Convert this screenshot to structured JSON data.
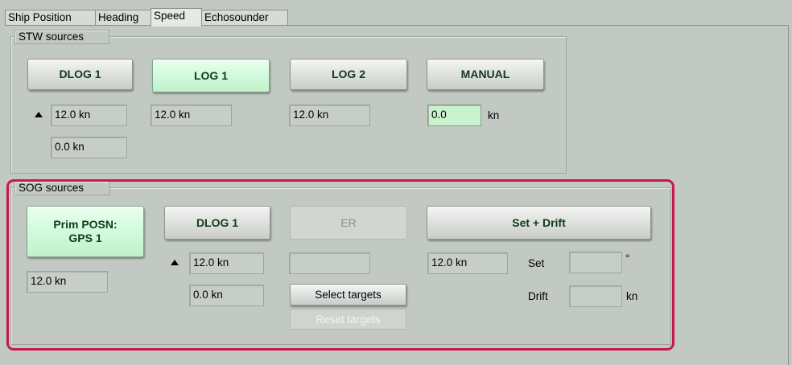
{
  "tabs": [
    "Ship Position",
    "Heading",
    "Speed",
    "Echosounder"
  ],
  "active_tab": "Speed",
  "stw": {
    "title": "STW sources",
    "buttons": {
      "dlog1": "DLOG 1",
      "log1": "LOG 1",
      "log2": "LOG 2",
      "manual": "MANUAL"
    },
    "dlog1_speed": "12.0 kn",
    "dlog1_speed2": "0.0 kn",
    "log1_speed": "12.0 kn",
    "log2_speed": "12.0 kn",
    "manual_value": "0.0",
    "manual_unit": "kn"
  },
  "sog": {
    "title": "SOG sources",
    "buttons": {
      "prim_posn": "Prim POSN:\nGPS 1",
      "dlog1": "DLOG 1",
      "er": "ER",
      "set_drift": "Set + Drift",
      "select_targets": "Select targets",
      "reset_targets": "Reset targets"
    },
    "prim_speed": "12.0 kn",
    "dlog1_speed": "12.0 kn",
    "dlog1_speed2": "0.0 kn",
    "er_speed": "",
    "set_drift_speed": "12.0 kn",
    "set_label": "Set",
    "set_value": "",
    "set_unit": "°",
    "drift_label": "Drift",
    "drift_value": "",
    "drift_unit": "kn"
  },
  "colors": {
    "background": "#c2c9c2",
    "active_button": "#d2fadc",
    "highlight": "#c61a4b"
  }
}
